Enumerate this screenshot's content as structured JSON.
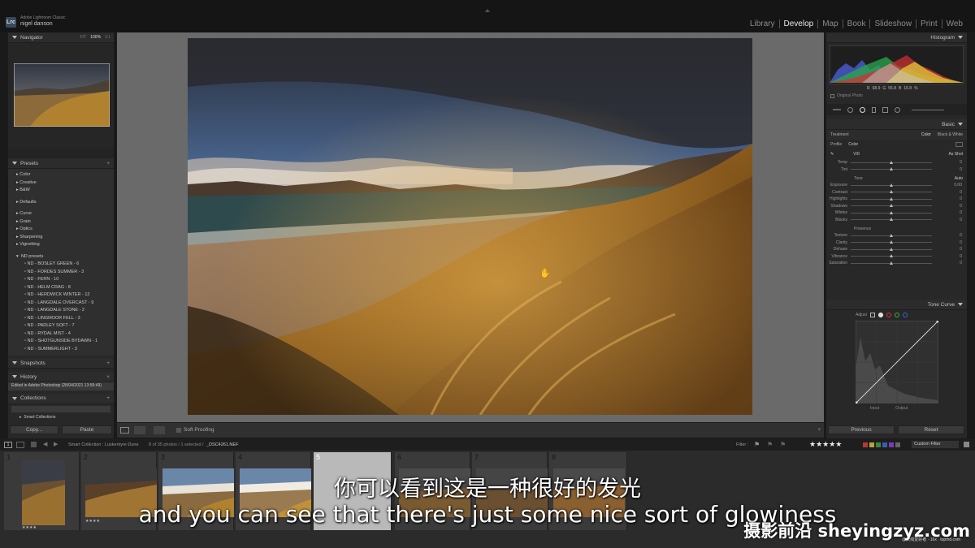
{
  "app": {
    "badge": "Lrc",
    "product_name": "Adobe Lightroom Classic",
    "user": "nigel danson"
  },
  "modules": [
    "Library",
    "Develop",
    "Map",
    "Book",
    "Slideshow",
    "Print",
    "Web"
  ],
  "left": {
    "navigator": {
      "title": "Navigator",
      "zoom": [
        "FIT",
        "100%",
        "3:1"
      ]
    },
    "presets": {
      "title": "Presets",
      "groups1": [
        "Color",
        "Creative",
        "B&W"
      ],
      "groups2": [
        "Defaults"
      ],
      "groups3": [
        "Curve",
        "Grain",
        "Optics",
        "Sharpening",
        "Vignetting"
      ],
      "nd_group": "ND presets",
      "nd_items": [
        "ND - BOSLEY GREEN - 6",
        "ND - FORDES SUMMER - 3",
        "ND - FERN - 10",
        "ND - HELM CRAG - 8",
        "ND - HERDWICK WINTER - 12",
        "ND - LANGDALE OVERCAST - 9",
        "ND - LANGDALE STONE - 2",
        "ND - LINGMOOR FELL - 3",
        "ND - PADLEY SOFT - 7",
        "ND - RYDAL MIST - 4",
        "ND - SHOTGUNSIDE BYDAWN - 1",
        "ND - SUMMERLIGHT - 3"
      ]
    },
    "snapshots": "Snapshots",
    "history": {
      "title": "History",
      "item": "Edited in Adobe Photoshop (28/04/2021 13:59:49)"
    },
    "collections": {
      "title": "Collections",
      "item": "Smart Collections"
    },
    "copy_button": "Copy...",
    "paste_button": "Paste"
  },
  "right": {
    "histogram": {
      "title": "Histogram",
      "readout": [
        "R",
        "68.9",
        "G",
        "55.8",
        "B",
        "16.8",
        "%"
      ],
      "original_photo": "Original Photo"
    },
    "basic": {
      "title": "Basic",
      "treatment_label": "Treatment",
      "treatment_color": "Color",
      "treatment_bw": "Black & White",
      "profile_label": "Profile",
      "profile_value": "Color",
      "wb_label": "WB",
      "wb_value": "As Shot",
      "wb_sliders": [
        {
          "label": "Temp",
          "value": "0"
        },
        {
          "label": "Tint",
          "value": "0"
        }
      ],
      "tone_label": "Tone",
      "tone_auto": "Auto",
      "tone_sliders": [
        {
          "label": "Exposure",
          "value": "0.00"
        },
        {
          "label": "Contrast",
          "value": "0"
        },
        {
          "label": "Highlights",
          "value": "0"
        },
        {
          "label": "Shadows",
          "value": "0"
        },
        {
          "label": "Whites",
          "value": "0"
        },
        {
          "label": "Blacks",
          "value": "0"
        }
      ],
      "presence_label": "Presence",
      "presence_sliders": [
        {
          "label": "Texture",
          "value": "0"
        },
        {
          "label": "Clarity",
          "value": "0"
        },
        {
          "label": "Dehaze",
          "value": "0"
        },
        {
          "label": "Vibrance",
          "value": "0"
        },
        {
          "label": "Saturation",
          "value": "0"
        }
      ]
    },
    "tone_curve": {
      "title": "Tone Curve",
      "adjust_label": "Adjust",
      "input_label": "Input",
      "output_label": "Output"
    },
    "previous_button": "Previous",
    "reset_button": "Reset"
  },
  "toolbar": {
    "soft_proofing": "Soft Proofing"
  },
  "filmstrip": {
    "source": "Smart Collection : Luskentyre Dune",
    "count": "8 of 35 photos / 1 selected /",
    "filename": "_DSC4261.NEF",
    "filter_label": "Filter :",
    "custom_filter": "Custom Filter",
    "numbers": [
      "1",
      "2",
      "3",
      "4",
      "5",
      "6",
      "7",
      "8"
    ],
    "rating_stars": "★★★★",
    "filter_stars": "★★★★★",
    "label_colors": [
      "#b33a3a",
      "#b8a33a",
      "#3a8a3a",
      "#3a5ab3",
      "#7a3ab3",
      "#666666"
    ]
  },
  "subtitles": {
    "chinese": "你可以看到这是一种很好的发光",
    "english": "and you can see that there's just some nice sort of glowiness"
  },
  "watermark": {
    "main": "摄影前沿 sheyingzyz.com",
    "small": "@天线爱好者 · 16x · topmd.com"
  }
}
